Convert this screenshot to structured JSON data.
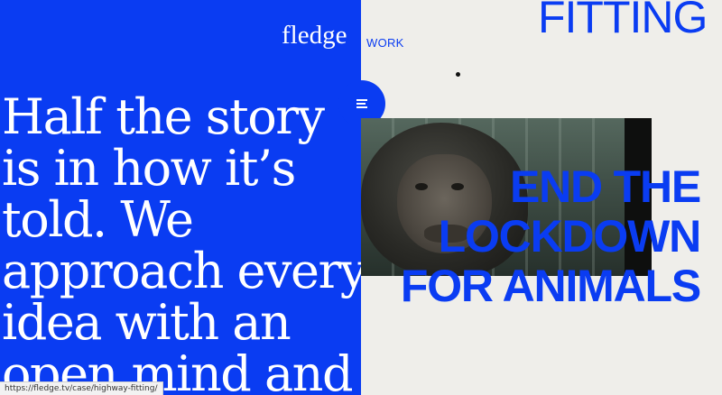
{
  "brand": {
    "logo_text": "fledge",
    "nav_label": "WORK"
  },
  "hero": {
    "text": "Half the story\nis in how it’s\ntold. We\napproach every\nidea with an\nopen mind and"
  },
  "project": {
    "title": "FITTING",
    "headline_lines": [
      "END THE",
      "LOCKDOWN",
      "FOR ANIMALS"
    ],
    "image_subject": "chimpanzee behind glass"
  },
  "status_bar": {
    "url": "https://fledge.tv/case/highway-fitting/"
  },
  "colors": {
    "brand_blue": "#0a3cf2",
    "background": "#efeeea",
    "text_on_blue": "#ffffff"
  },
  "icons": {
    "menu": "hamburger-menu-icon"
  }
}
